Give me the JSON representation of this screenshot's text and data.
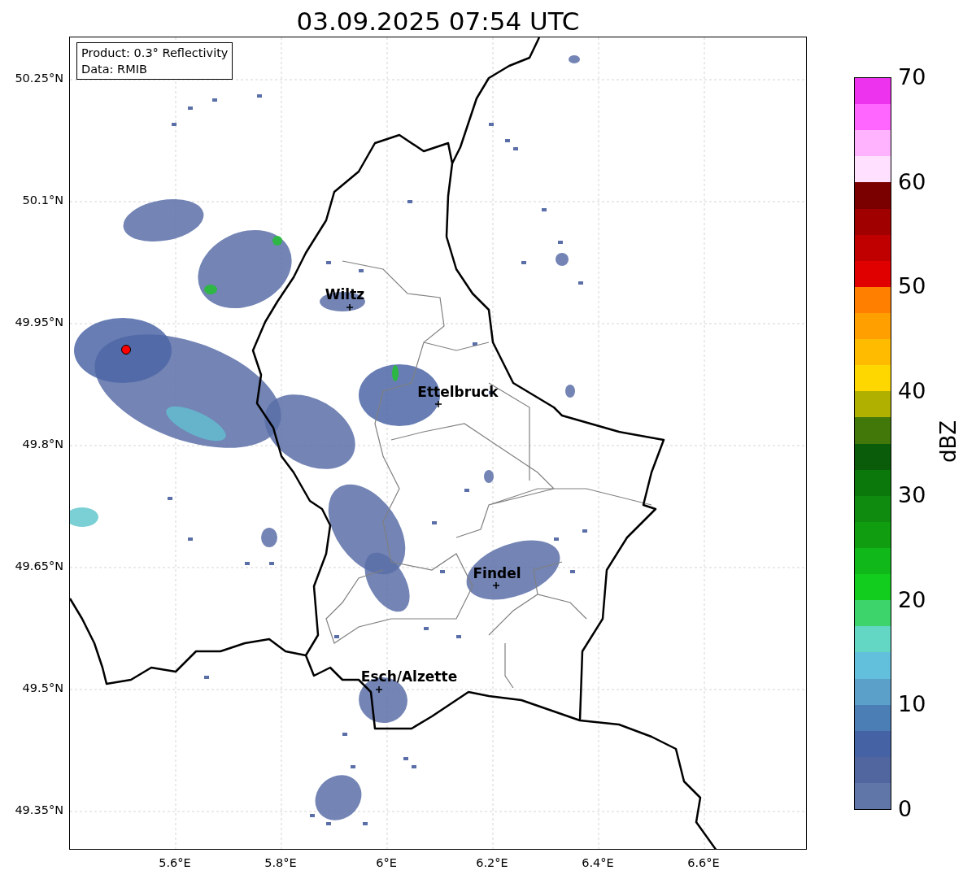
{
  "title": "03.09.2025 07:54 UTC",
  "info_box": [
    "Product: 0.3° Reflectivity",
    "Data: RMIB"
  ],
  "x_ticks": [
    "5.6°E",
    "5.8°E",
    "6°E",
    "6.2°E",
    "6.4°E",
    "6.6°E"
  ],
  "y_ticks": [
    "50.25°N",
    "50.1°N",
    "49.95°N",
    "49.8°N",
    "49.65°N",
    "49.5°N",
    "49.35°N"
  ],
  "cities": [
    {
      "name": "Wiltz"
    },
    {
      "name": "Ettelbruck"
    },
    {
      "name": "Findel"
    },
    {
      "name": "Esch/Alzette"
    }
  ],
  "radar_site": {
    "color": "#ff0000"
  },
  "colorbar": {
    "label": "dBZ",
    "ticks": [
      "70",
      "60",
      "50",
      "40",
      "30",
      "20",
      "10",
      "0"
    ],
    "segments": [
      {
        "color": "#ee33ee"
      },
      {
        "color": "#ff66ff"
      },
      {
        "color": "#ffb3ff"
      },
      {
        "color": "#ffe0ff"
      },
      {
        "color": "#7a0000"
      },
      {
        "color": "#a00000"
      },
      {
        "color": "#c00000"
      },
      {
        "color": "#e00000"
      },
      {
        "color": "#ff7f00"
      },
      {
        "color": "#ff9f00"
      },
      {
        "color": "#ffbb00"
      },
      {
        "color": "#ffd700"
      },
      {
        "color": "#b0b000"
      },
      {
        "color": "#42780a"
      },
      {
        "color": "#0a5c0a"
      },
      {
        "color": "#0a780a"
      },
      {
        "color": "#0f8c0f"
      },
      {
        "color": "#109e10"
      },
      {
        "color": "#10b81a"
      },
      {
        "color": "#12cc1e"
      },
      {
        "color": "#3ed46c"
      },
      {
        "color": "#63d6c4"
      },
      {
        "color": "#63c0dd"
      },
      {
        "color": "#5aa0c8"
      },
      {
        "color": "#4a7eb4"
      },
      {
        "color": "#4462a4"
      },
      {
        "color": "#51659e"
      },
      {
        "color": "#6176a8"
      }
    ]
  }
}
